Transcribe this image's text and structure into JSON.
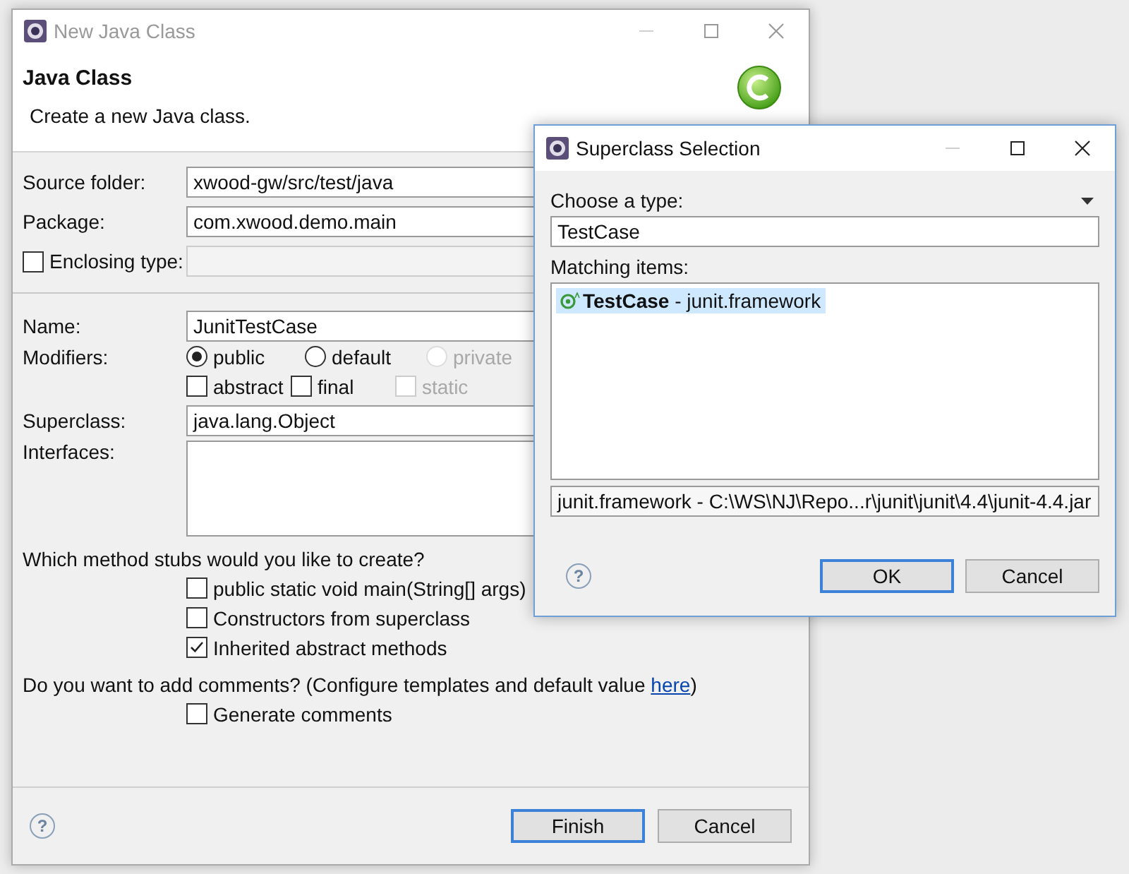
{
  "new_class_dialog": {
    "title": "New Java Class",
    "active": false,
    "heading": "Java Class",
    "description": "Create a new Java class.",
    "source_folder": {
      "label": "Source folder:",
      "value": "xwood-gw/src/test/java"
    },
    "package": {
      "label": "Package:",
      "value": "com.xwood.demo.main"
    },
    "enclosing_type": {
      "label": "Enclosing type:",
      "checked": false
    },
    "name": {
      "label": "Name:",
      "value": "JunitTestCase"
    },
    "modifiers": {
      "label": "Modifiers:",
      "access": [
        {
          "label": "public",
          "selected": true,
          "disabled": false
        },
        {
          "label": "default",
          "selected": false,
          "disabled": false
        },
        {
          "label": "private",
          "selected": false,
          "disabled": true
        }
      ],
      "flags": [
        {
          "label": "abstract",
          "checked": false,
          "disabled": false
        },
        {
          "label": "final",
          "checked": false,
          "disabled": false
        },
        {
          "label": "static",
          "checked": false,
          "disabled": true
        }
      ]
    },
    "superclass": {
      "label": "Superclass:",
      "value": "java.lang.Object"
    },
    "interfaces": {
      "label": "Interfaces:"
    },
    "stubs": {
      "question": "Which method stubs would you like to create?",
      "options": [
        {
          "label": "public static void main(String[] args)",
          "checked": false
        },
        {
          "label": "Constructors from superclass",
          "checked": false
        },
        {
          "label": "Inherited abstract methods",
          "checked": true
        }
      ]
    },
    "comments": {
      "question": "Do you want to add comments? (Configure templates and default value ",
      "link": "here",
      "question_end": ")",
      "options": [
        {
          "label": "Generate comments",
          "checked": false
        }
      ]
    },
    "help": "?",
    "buttons": [
      {
        "label": "Finish",
        "default": true
      },
      {
        "label": "Cancel",
        "default": false
      }
    ]
  },
  "superclass_dialog": {
    "title": "Superclass Selection",
    "active": true,
    "filter_label": "Choose a type:",
    "filter_value": "TestCase",
    "matching_label": "Matching items:",
    "items": [
      {
        "text": "**TestCase** - junit.framework",
        "selected": true
      }
    ],
    "status": "junit.framework - C:\\WS\\NJ\\Repo...r\\junit\\junit\\4.4\\junit-4.4.jar",
    "help": "?",
    "buttons": [
      {
        "label": "OK",
        "default": true
      },
      {
        "label": "Cancel",
        "default": false
      }
    ]
  }
}
